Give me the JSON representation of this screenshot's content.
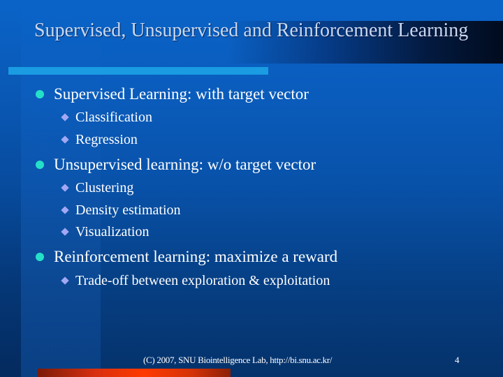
{
  "slide": {
    "title": "Supervised, Unsupervised and Reinforcement Learning",
    "bullets": [
      {
        "text": "Supervised Learning: with target vector",
        "subitems": [
          "Classification",
          "Regression"
        ]
      },
      {
        "text": "Unsupervised learning: w/o target vector",
        "subitems": [
          "Clustering",
          "Density estimation",
          "Visualization"
        ]
      },
      {
        "text": "Reinforcement learning: maximize a reward",
        "subitems": [
          "Trade-off between exploration & exploitation"
        ]
      }
    ],
    "footer": "(C) 2007, SNU Biointelligence Lab, http://bi.snu.ac.kr/",
    "page_number": "4"
  },
  "theme": {
    "level1_bullet_color": "#25e0c8",
    "level2_bullet_color": "#a2a8f4",
    "title_color": "#c9d9ef",
    "underline_color": "#1a9be2",
    "accent_bar_color": "#ff3a00"
  }
}
